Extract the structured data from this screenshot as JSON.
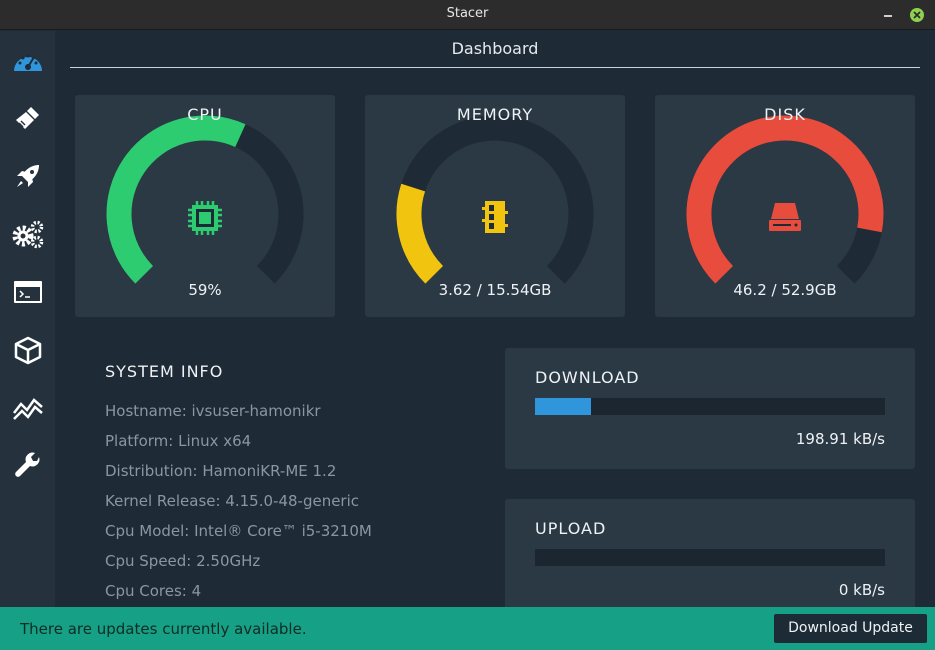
{
  "window": {
    "title": "Stacer"
  },
  "sidebar": {
    "items": [
      {
        "icon": "dashboard-gauge-icon",
        "active": true
      },
      {
        "icon": "broom-cleaner-icon"
      },
      {
        "icon": "rocket-startup-icon"
      },
      {
        "icon": "gears-services-icon"
      },
      {
        "icon": "terminal-processes-icon"
      },
      {
        "icon": "package-uninstaller-icon"
      },
      {
        "icon": "chart-resources-icon"
      },
      {
        "icon": "wrench-tools-icon"
      }
    ]
  },
  "page": {
    "title": "Dashboard"
  },
  "gauges": {
    "cpu": {
      "title": "CPU",
      "value": "59%",
      "percent": 59,
      "color": "#2ecc71"
    },
    "memory": {
      "title": "MEMORY",
      "value": "3.62 / 15.54GB",
      "percent": 23.3,
      "color": "#f1c40f"
    },
    "disk": {
      "title": "DISK",
      "value": "46.2 / 52.9GB",
      "percent": 87.3,
      "color": "#e74c3c"
    }
  },
  "system_info": {
    "heading": "SYSTEM INFO",
    "rows": [
      "Hostname: ivsuser-hamonikr",
      "Platform: Linux x64",
      "Distribution: HamoniKR-ME 1.2",
      "Kernel Release: 4.15.0-48-generic",
      "Cpu Model: Intel® Core™ i5-3210M",
      "Cpu Speed: 2.50GHz",
      "Cpu Cores: 4"
    ]
  },
  "network": {
    "download": {
      "title": "DOWNLOAD",
      "rate": "198.91 kB/s",
      "fraction": 0.16
    },
    "upload": {
      "title": "UPLOAD",
      "rate": "0 kB/s",
      "fraction": 0
    }
  },
  "statusbar": {
    "message": "There are updates currently available.",
    "button": "Download Update"
  },
  "colors": {
    "accent_blue": "#2f96dc",
    "status_green": "#16a085",
    "track": "#1e2a35"
  }
}
